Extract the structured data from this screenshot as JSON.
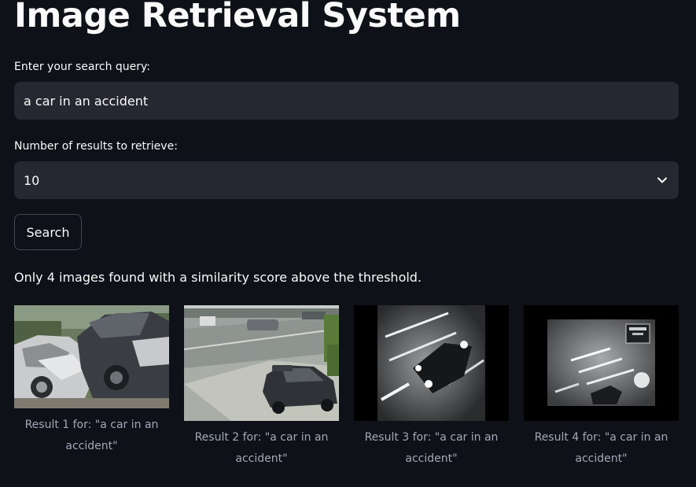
{
  "app": {
    "title": "Image Retrieval System"
  },
  "query": {
    "label": "Enter your search query:",
    "value": "a car in an accident"
  },
  "num_results": {
    "label": "Number of results to retrieve:",
    "selected": "10"
  },
  "search_button": {
    "label": "Search"
  },
  "status": {
    "message": "Only 4 images found with a similarity score above the threshold."
  },
  "results": [
    {
      "caption": "Result 1 for: \"a car in an accident\"",
      "image": "crashed-cars-photo"
    },
    {
      "caption": "Result 2 for: \"a car in an accident\"",
      "image": "street-intersection-photo"
    },
    {
      "caption": "Result 3 for: \"a car in an accident\"",
      "image": "night-cctv-car-photo"
    },
    {
      "caption": "Result 4 for: \"a car in an accident\"",
      "image": "night-cctv-street-photo"
    }
  ],
  "icons": {
    "select_chevron": "chevron-down-icon"
  },
  "colors": {
    "background": "#0e1117",
    "input_background": "#262730",
    "text": "#fafafa",
    "caption_text": "#a3a8b8",
    "button_border": "#454652"
  }
}
